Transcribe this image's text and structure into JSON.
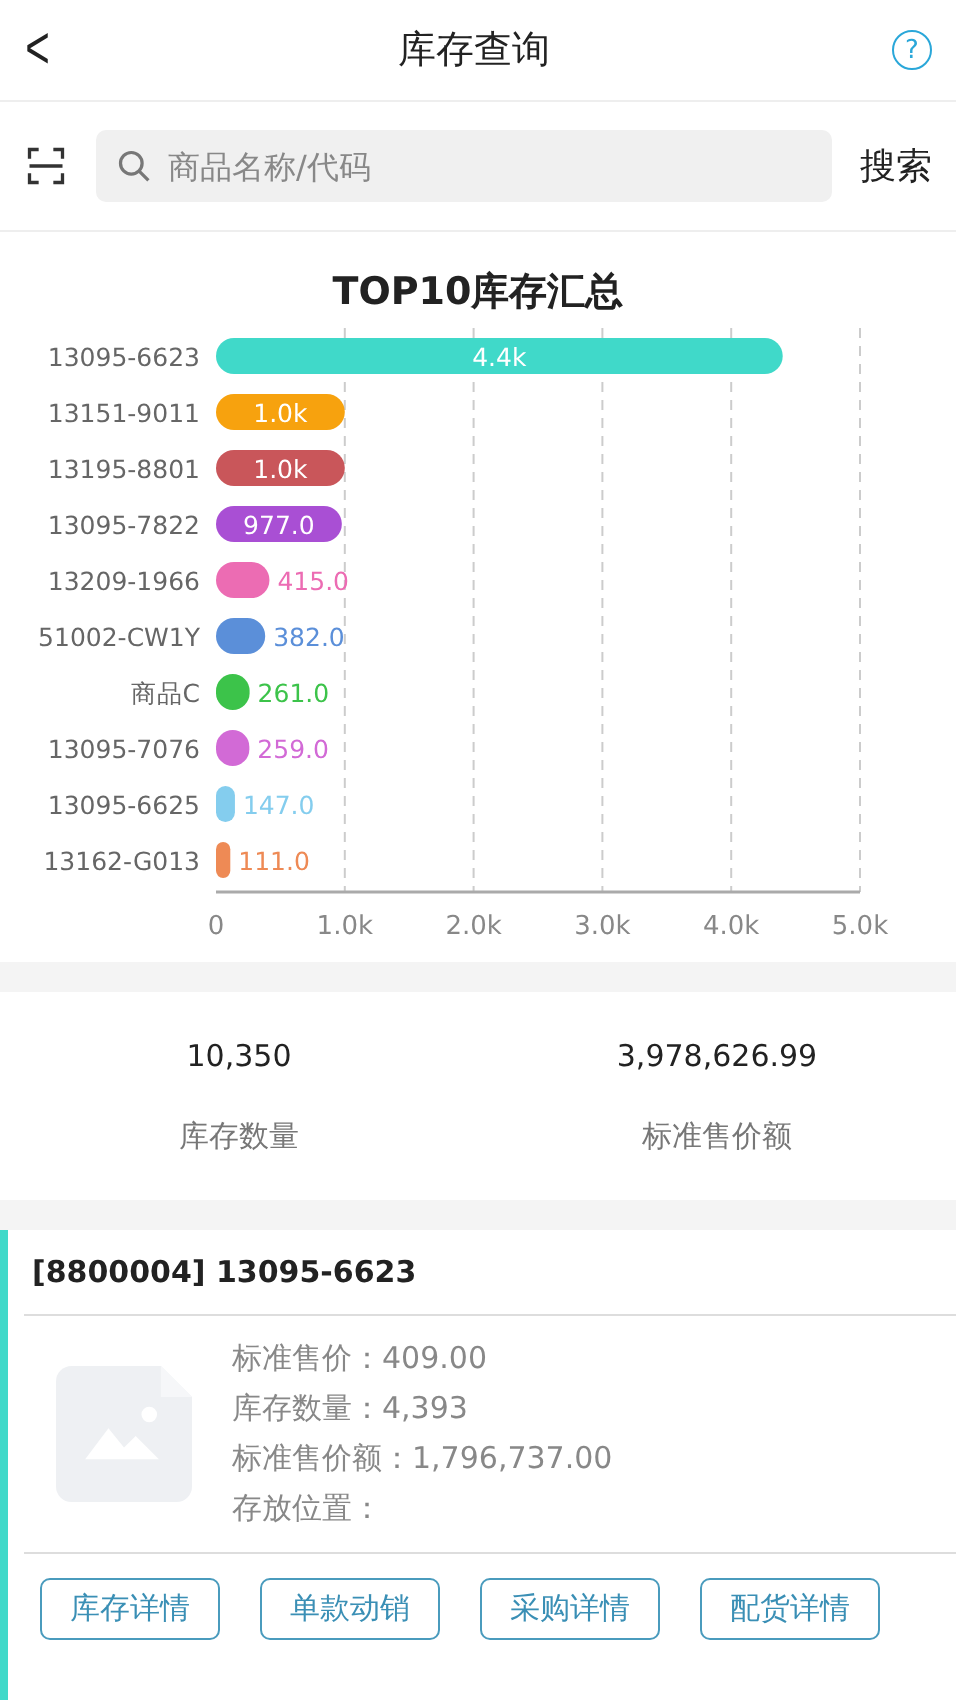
{
  "header": {
    "title": "库存查询",
    "back": "<",
    "help": "?"
  },
  "search": {
    "placeholder": "商品名称/代码",
    "button": "搜索"
  },
  "chart_data": {
    "type": "bar",
    "orientation": "horizontal",
    "title": "TOP10库存汇总",
    "categories": [
      "13095-6623",
      "13151-9011",
      "13195-8801",
      "13095-7822",
      "13209-1966",
      "51002-CW1Y",
      "商品C",
      "13095-7076",
      "13095-6625",
      "13162-G013"
    ],
    "stacked": true,
    "grid": true,
    "series": [
      {
        "color": "#40d9c9",
        "values": [
          4400,
          null,
          null,
          null,
          null,
          null,
          null,
          null,
          null,
          null
        ]
      },
      {
        "color": "#f7a20e",
        "values": [
          null,
          1000,
          null,
          null,
          null,
          null,
          null,
          null,
          null,
          null
        ]
      },
      {
        "color": "#c9565a",
        "values": [
          null,
          null,
          1000,
          null,
          null,
          null,
          null,
          null,
          null,
          null
        ]
      },
      {
        "color": "#a94fd4",
        "values": [
          null,
          null,
          null,
          977,
          null,
          null,
          null,
          null,
          null,
          null
        ]
      },
      {
        "color": "#ec6cb3",
        "values": [
          null,
          null,
          null,
          null,
          415,
          null,
          null,
          null,
          null,
          null
        ]
      },
      {
        "color": "#5b8fd9",
        "values": [
          null,
          null,
          null,
          null,
          null,
          382,
          null,
          null,
          null,
          null
        ]
      },
      {
        "color": "#3cc34a",
        "values": [
          null,
          null,
          null,
          null,
          null,
          null,
          261,
          null,
          null,
          null
        ]
      },
      {
        "color": "#d26ad6",
        "values": [
          null,
          null,
          null,
          null,
          null,
          null,
          null,
          259,
          null,
          null
        ]
      },
      {
        "color": "#84cdee",
        "values": [
          null,
          null,
          null,
          null,
          null,
          null,
          null,
          null,
          147,
          null
        ]
      },
      {
        "color": "#ee8a55",
        "values": [
          null,
          null,
          null,
          null,
          null,
          null,
          null,
          null,
          null,
          111
        ]
      }
    ],
    "value_labels": [
      "4.4k",
      "1.0k",
      "1.0k",
      "977.0",
      "415.0",
      "382.0",
      "261.0",
      "259.0",
      "147.0",
      "111.0"
    ],
    "xlim": [
      0,
      5000
    ],
    "xticks": [
      {
        "value": 0,
        "label": "0"
      },
      {
        "value": 1000,
        "label": "1.0k"
      },
      {
        "value": 2000,
        "label": "2.0k"
      },
      {
        "value": 3000,
        "label": "3.0k"
      },
      {
        "value": 4000,
        "label": "4.0k"
      },
      {
        "value": 5000,
        "label": "5.0k"
      }
    ]
  },
  "summary": [
    {
      "value": "10,350",
      "label": "库存数量"
    },
    {
      "value": "3,978,626.99",
      "label": "标准售价额"
    }
  ],
  "item": {
    "title": "[8800004] 13095-6623",
    "fields": [
      "标准售价：409.00",
      "库存数量：4,393",
      "标准售价额：1,796,737.00",
      "存放位置："
    ],
    "buttons": [
      "库存详情",
      "单款动销",
      "采购详情",
      "配货详情"
    ]
  }
}
